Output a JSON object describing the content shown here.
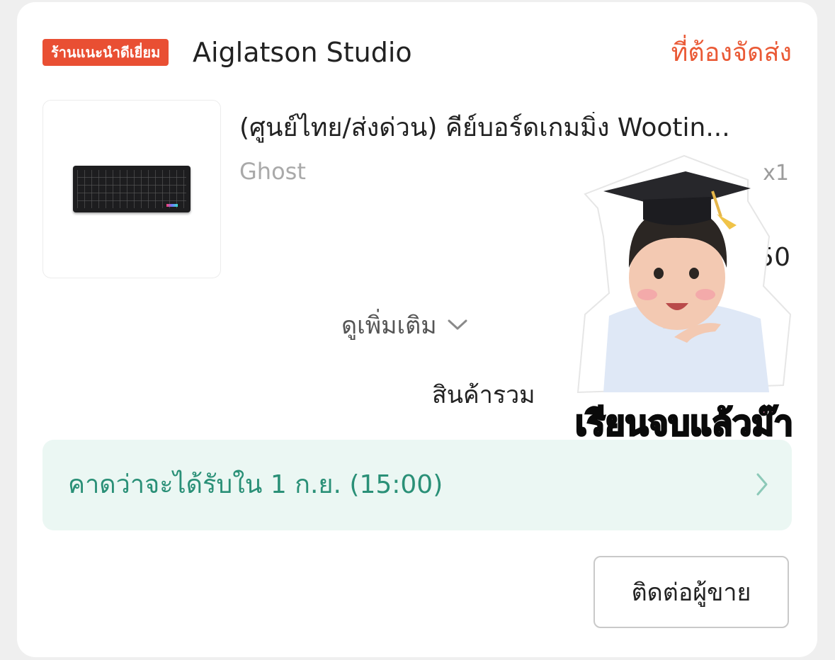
{
  "shop": {
    "badge": "ร้านแนะนำดีเยี่ยม",
    "name": "Aiglatson Studio",
    "status": "ที่ต้องจัดส่ง"
  },
  "product": {
    "image_icon": "keyboard-image",
    "title": "(ศูนย์ไทย/ส่งด่วน) คีย์บอร์ดเกมมิ่ง Wootin...",
    "variant": "Ghost",
    "quantity": "x1",
    "price": "150"
  },
  "see_more": {
    "label": "ดูเพิ่มเติม",
    "icon": "chevron-down-icon"
  },
  "summary": {
    "total_label": "สินค้ารวม"
  },
  "delivery": {
    "text": "คาดว่าจะได้รับใน 1 ก.ย. (15:00)",
    "icon": "chevron-right-icon"
  },
  "actions": {
    "contact_seller": "ติดต่อผู้ขาย"
  },
  "sticker": {
    "text": "เรียนจบแล้วม๊า"
  },
  "colors": {
    "accent": "#ea5a36",
    "badge_bg": "#e94f33",
    "delivery_bg": "#ebf7f3",
    "delivery_text": "#2a9077",
    "sticker_text": "#ff8fc6"
  }
}
